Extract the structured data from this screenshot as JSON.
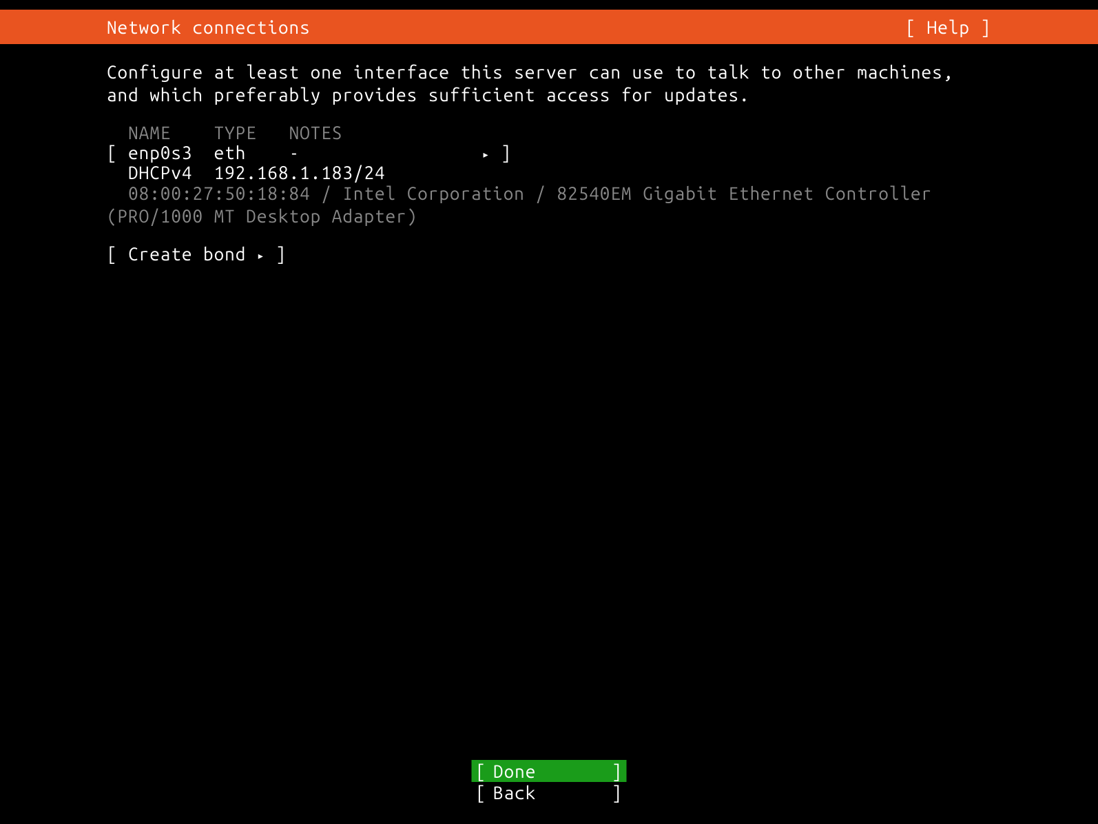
{
  "header": {
    "title": "Network connections",
    "help_label": "[ Help ]"
  },
  "description": "Configure at least one interface this server can use to talk to other machines, and which preferably provides sufficient access for updates.",
  "table": {
    "columns": {
      "name": "NAME",
      "type": "TYPE",
      "notes": "NOTES"
    },
    "interface": {
      "bracket_open": "[",
      "name": "enp0s3",
      "type": "eth",
      "notes": "-",
      "arrow": "▸",
      "bracket_close": "]",
      "dhcp_label": "DHCPv4",
      "ip": "192.168.1.183/24",
      "hardware": "08:00:27:50:18:84 / Intel Corporation / 82540EM Gigabit Ethernet Controller (PRO/1000 MT Desktop Adapter)"
    }
  },
  "create_bond": {
    "bracket_open": "[",
    "label": "Create bond",
    "arrow": "▸",
    "bracket_close": "]"
  },
  "buttons": {
    "done": {
      "bracket_open": "[",
      "label": "Done",
      "bracket_close": "]"
    },
    "back": {
      "bracket_open": "[",
      "label": "Back",
      "bracket_close": "]"
    }
  }
}
